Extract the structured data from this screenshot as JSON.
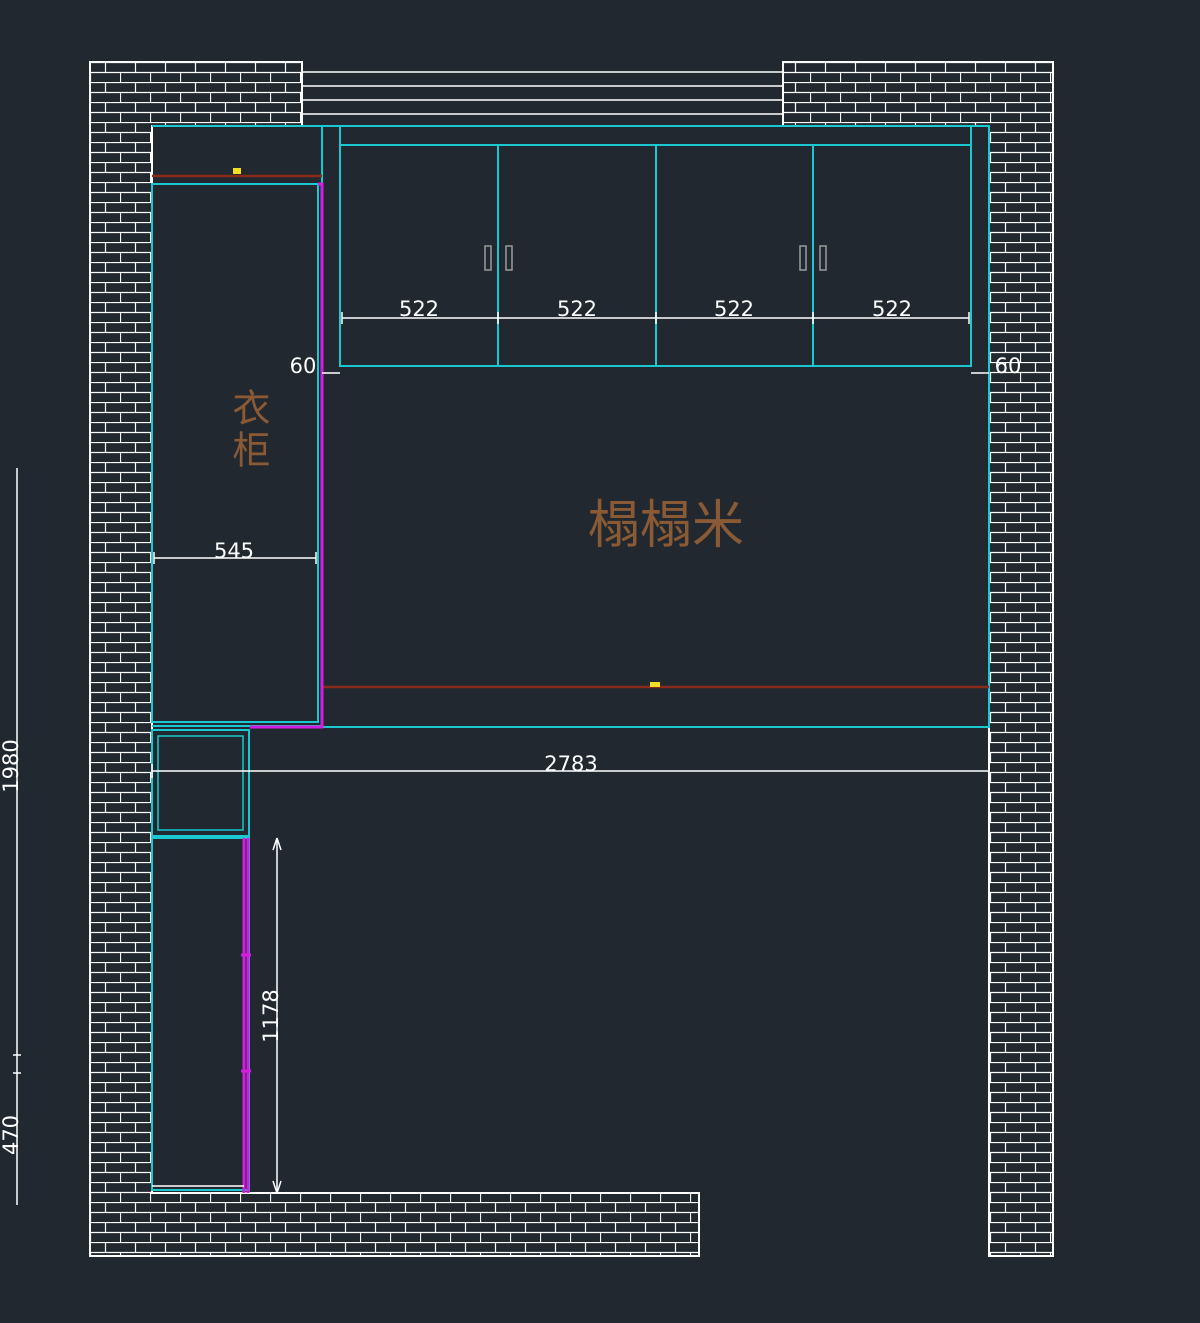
{
  "drawing": {
    "labels": {
      "wardrobe": "衣柜",
      "tatami": "榻榻米"
    },
    "dimensions": {
      "door_width_1": "522",
      "door_width_2": "522",
      "door_width_3": "522",
      "door_width_4": "522",
      "side_gap_left": "60",
      "side_gap_right": "60",
      "wardrobe_depth": "545",
      "room_width": "2783",
      "overall_height_left": "1980",
      "lower_left_height": "470",
      "cabinet_height": "1178"
    },
    "colors": {
      "background": "#212830",
      "wall_hatch": "#ffffff",
      "furniture_outline": "#19c8d0",
      "panel_magenta": "#d21ee0",
      "edge_line": "#8a2a18",
      "marker": "#f0e020",
      "label_text": "#8a5a34",
      "dimension": "#ffffff"
    }
  }
}
